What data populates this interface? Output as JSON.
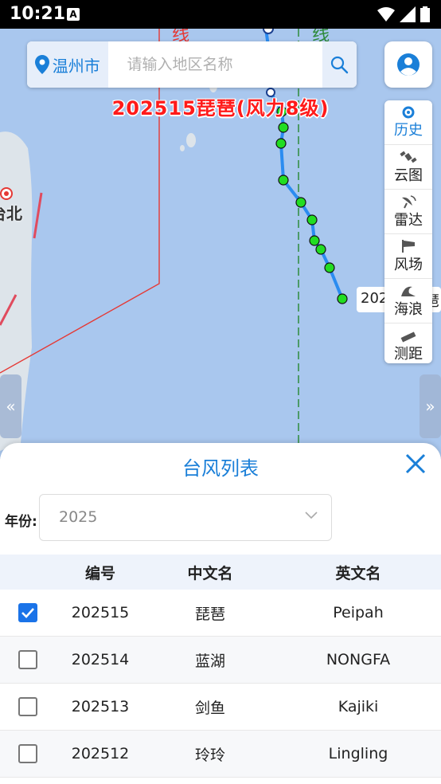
{
  "status_bar": {
    "time": "10:21",
    "badge": "A"
  },
  "map": {
    "search": {
      "city": "温州市",
      "placeholder": "请输入地区名称"
    },
    "storm_title": "202515琵琶(风力8级)",
    "partial_labels": {
      "left_top": "线",
      "right_top": "线",
      "taipei": "台北",
      "track_tip": "202",
      "track_tip_tail": "琶"
    },
    "toolbar": [
      {
        "label": "历史",
        "icon": "history-typhoon-icon",
        "active": true
      },
      {
        "label": "云图",
        "icon": "satellite-icon",
        "active": false
      },
      {
        "label": "雷达",
        "icon": "radar-icon",
        "active": false
      },
      {
        "label": "风场",
        "icon": "wind-flag-icon",
        "active": false
      },
      {
        "label": "海浪",
        "icon": "wave-icon",
        "active": false
      },
      {
        "label": "测距",
        "icon": "ruler-icon",
        "active": false
      }
    ],
    "left_arrow": "«",
    "right_arrow": "»"
  },
  "sheet": {
    "title": "台风列表",
    "year_label": "年份:",
    "year_value": "2025",
    "columns": {
      "id": "编号",
      "cn": "中文名",
      "en": "英文名"
    },
    "rows": [
      {
        "id": "202515",
        "cn": "琵琶",
        "en": "Peipah",
        "checked": true
      },
      {
        "id": "202514",
        "cn": "蓝湖",
        "en": "NONGFA",
        "checked": false
      },
      {
        "id": "202513",
        "cn": "剑鱼",
        "en": "Kajiki",
        "checked": false
      },
      {
        "id": "202512",
        "cn": "玲玲",
        "en": "Lingling",
        "checked": false
      }
    ]
  },
  "colors": {
    "accent": "#1a7fd8",
    "storm_title": "#ff1a1a",
    "track": "#2b8cf0",
    "track_point": "#22dd22",
    "sea": "#a9c7ee",
    "land": "#dde4ea"
  }
}
